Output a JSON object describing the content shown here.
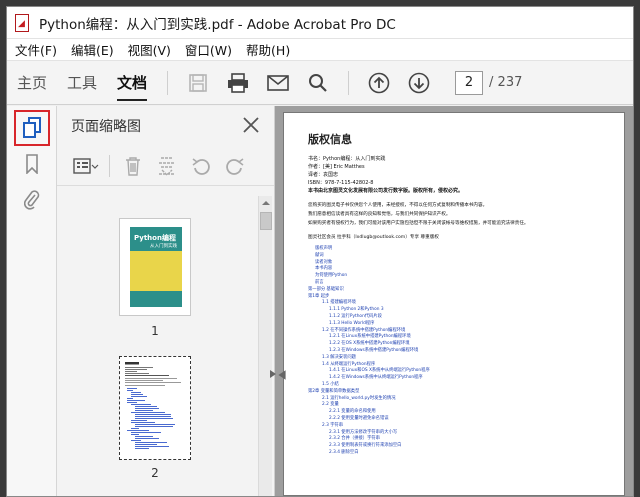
{
  "window": {
    "title": "Python编程：从入门到实践.pdf - Adobe Acrobat Pro DC"
  },
  "menu": [
    "文件(F)",
    "编辑(E)",
    "视图(V)",
    "窗口(W)",
    "帮助(H)"
  ],
  "toolbar": {
    "tabs": [
      "主页",
      "工具",
      "文档"
    ],
    "active_tab": "文档",
    "current_page": "2",
    "page_total": "/ 237"
  },
  "panel": {
    "title": "页面缩略图",
    "thumbnails": [
      {
        "label": "1",
        "cover_title": "Python编程",
        "cover_sub": "从入门到实践"
      },
      {
        "label": "2"
      }
    ]
  },
  "document": {
    "heading": "版权信息",
    "meta": [
      "书名：Python编程：从入门到实践",
      "作者：[美] Eric Matthes",
      "译者：袁国忠",
      "ISBN：978-7-115-42802-8",
      "本书由北京图灵文化发展有限公司发行数字版。版权所有，侵权必究。"
    ],
    "paragraphs": [
      "您购买的图灵电子书仅供您个人使用，未经授权，不得以任何方式复制和传播本书内容。",
      "我们愿意相信读者具有这样的良知和觉悟，与我们共同保护知识产权。",
      "如果购买者有侵权行为，我们可能对该用户实施包括但不限于关闭该帐号等维权措施，并可能追究法律责任。"
    ],
    "contact": "图灵社区会员 拉手科（lxdlugb@outlook.com）专享 尊重版权",
    "toc": [
      "版权声明",
      "献词",
      "读者对象",
      "本书内容",
      "为何使用Python",
      "前言",
      "第一部分 基础知识",
      "第1章 起步",
      "1.1 搭建编程环境",
      "1.1.1 Python 2和Python 3",
      "1.1.2 运行Python代码片段",
      "1.1.3 Hello World程序",
      "1.2 在不同操作系统中搭建Python编程环境",
      "1.2.1 在Linux系统中搭建Python编程环境",
      "1.2.2 在OS X系统中搭建Python编程环境",
      "1.2.3 在Windows系统中搭建Python编程环境",
      "1.3 解决安装问题",
      "1.4 从终端运行Python程序",
      "1.4.1 在Linux和OS X系统中从终端运行Python程序",
      "1.4.2 在Windows系统中从终端运行Python程序",
      "1.5 小结",
      "第2章 变量和简单数据类型",
      "2.1 运行hello_world.py时发生的情况",
      "2.2 变量",
      "2.2.1 变量的命名和使用",
      "2.2.2 使用变量时避免命名错误",
      "2.3 字符串",
      "2.3.1 使用方法修改字符串的大小写",
      "2.3.2 合并（拼接）字符串",
      "2.3.3 使用制表符或换行符来添加空白",
      "2.3.4 删除空白"
    ]
  },
  "icons": [
    "save-icon",
    "print-icon",
    "mail-icon",
    "search-icon",
    "prev-page-icon",
    "next-page-icon",
    "thumbnails-icon",
    "bookmark-icon",
    "attachment-icon",
    "close-icon",
    "options-icon",
    "delete-icon",
    "extract-icon",
    "rotate-ccw-icon",
    "rotate-cw-icon"
  ],
  "colors": {
    "accent_red": "#d8262b",
    "toc_link": "#1c3fb0"
  }
}
